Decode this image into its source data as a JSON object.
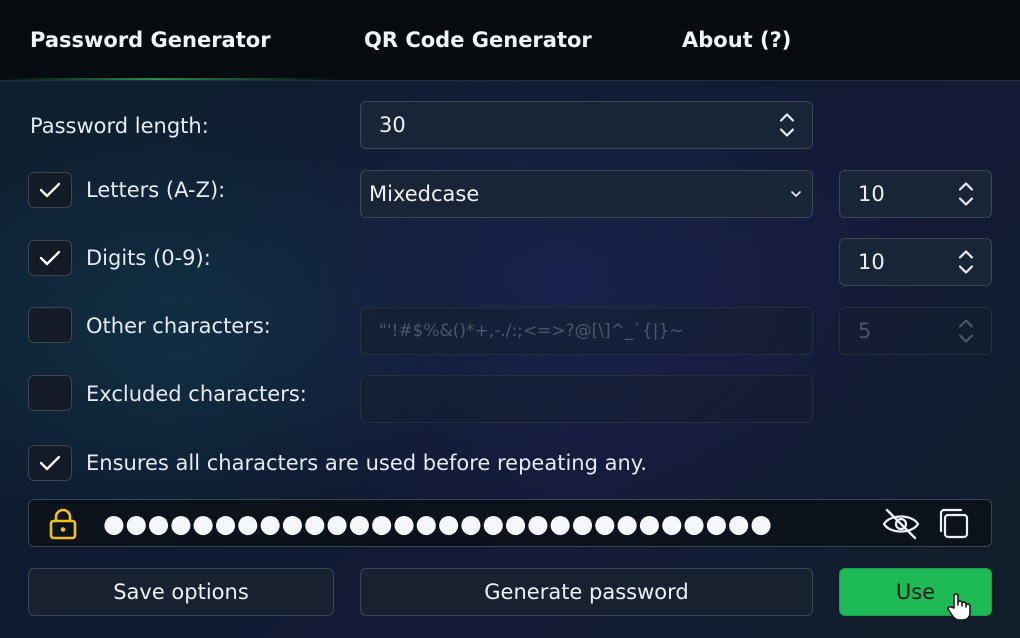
{
  "tabs": [
    {
      "label": "Password Generator"
    },
    {
      "label": "QR Code Generator"
    },
    {
      "label": "About (?)"
    }
  ],
  "options": {
    "length": {
      "label": "Password length:",
      "value": "30"
    },
    "letters": {
      "label": "Letters (A-Z):",
      "checked": true,
      "case_selected": "Mixedcase",
      "count": "10"
    },
    "digits": {
      "label": "Digits (0-9):",
      "checked": true,
      "count": "10"
    },
    "other": {
      "label": "Other characters:",
      "checked": false,
      "chars": "\"'!#$%&()*+,-./:;<=>?@[\\]^_`{|}~",
      "count": "5"
    },
    "excluded": {
      "label": "Excluded characters:",
      "checked": false,
      "value": ""
    },
    "ensure_all": {
      "label": "Ensures all characters are used before repeating any.",
      "checked": true
    }
  },
  "output": {
    "masked_password": "●●●●●●●●●●●●●●●●●●●●●●●●●●●●●●"
  },
  "buttons": {
    "save": "Save options",
    "generate": "Generate password",
    "use": "Use"
  },
  "icons": {
    "lock": "lock-icon",
    "visibility": "eye-slash-icon",
    "copy": "copy-icon"
  },
  "colors": {
    "accent": "#1db954",
    "lock": "#f2c317"
  }
}
